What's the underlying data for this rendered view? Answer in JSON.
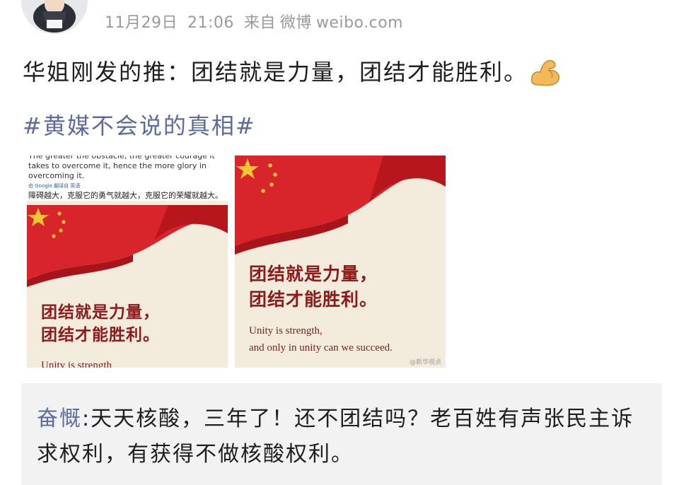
{
  "post": {
    "date": "11月29日",
    "time": "21:06",
    "source_prefix": "来自",
    "source_app": "微博",
    "source_site": "weibo.com",
    "text": "华姐刚发的推：团结就是力量，团结才能胜利。",
    "emoji": "flexed-biceps",
    "topic": "#黄媒不会说的真相#"
  },
  "images": [
    {
      "quote_en": "The greater the obstacle, the greater courage it takes to overcome it, hence the more glory in overcoming it.",
      "quote_source": "由 Google 翻译自 英语",
      "quote_zh": "障碍越大，克服它的勇气就越大，克服它的荣耀就越大。",
      "poster_zh_line1": "团结就是力量，",
      "poster_zh_line2": "团结才能胜利。",
      "poster_en_line1": "Unity is strength",
      "poster_en_line2": ""
    },
    {
      "poster_zh_line1": "团结就是力量，",
      "poster_zh_line2": "团结才能胜利。",
      "poster_en_line1": "Unity is strength,",
      "poster_en_line2": "and only in unity can we succeed.",
      "watermark": "@新华视点"
    }
  ],
  "comment": {
    "user": "奋慨",
    "separator": ":",
    "text": "天天核酸，三年了！还不团结吗？老百姓有声张民主诉求权利，有获得不做核酸权利。"
  },
  "colors": {
    "topic_link": "#5b6aa0",
    "meta_gray": "#9a9a9a",
    "comment_bg": "#f2f2f2",
    "flag_red": "#d8252b",
    "star_yellow": "#f7c531"
  }
}
